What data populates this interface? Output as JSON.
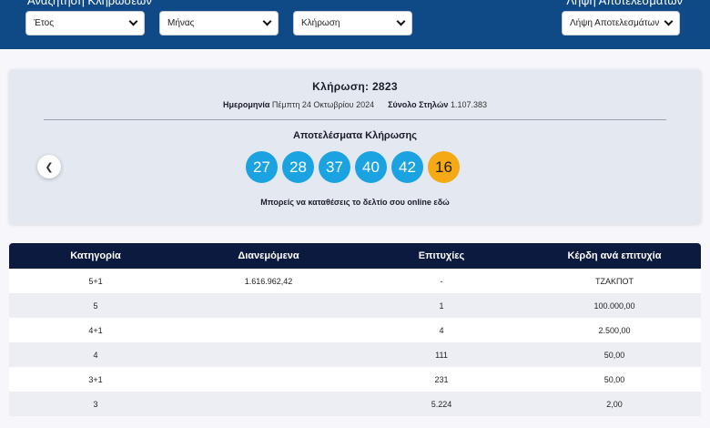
{
  "header": {
    "search_title": "Αναζήτηση Κληρώσεων",
    "results_title": "Λήψη Αποτελεσμάτων",
    "year_select": "Έτος",
    "month_select": "Μήνας",
    "draw_select": "Κλήρωση",
    "results_select": "Λήψη Αποτελεσμάτων"
  },
  "draw": {
    "title": "Κλήρωση: 2823",
    "date_label": "Ημερομηνία",
    "date_value": "Πέμπτη 24 Οκτωβρίου 2024",
    "columns_label": "Σύνολο Στηλών",
    "columns_value": "1.107.383",
    "results_title": "Αποτελέσματα Κλήρωσης",
    "numbers": [
      "27",
      "28",
      "37",
      "40",
      "42"
    ],
    "bonus": "16",
    "online_text": "Μπορείς να καταθέσεις το δελτίο σου online",
    "online_link": "εδώ"
  },
  "colors": {
    "header_bg": "#0f4a87",
    "ball_blue": "#1aa3e0",
    "ball_bonus": "#f4a915",
    "table_head": "#0d1a40"
  },
  "table": {
    "headers": [
      "Κατηγορία",
      "Διανεμόμενα",
      "Επιτυχίες",
      "Κέρδη ανά επιτυχία"
    ],
    "rows": [
      [
        "5+1",
        "1.616.962,42",
        "-",
        "ΤΖΑΚΠΟΤ"
      ],
      [
        "5",
        "",
        "1",
        "100.000,00"
      ],
      [
        "4+1",
        "",
        "4",
        "2.500,00"
      ],
      [
        "4",
        "",
        "111",
        "50,00"
      ],
      [
        "3+1",
        "",
        "231",
        "50,00"
      ],
      [
        "3",
        "",
        "5.224",
        "2,00"
      ]
    ]
  }
}
